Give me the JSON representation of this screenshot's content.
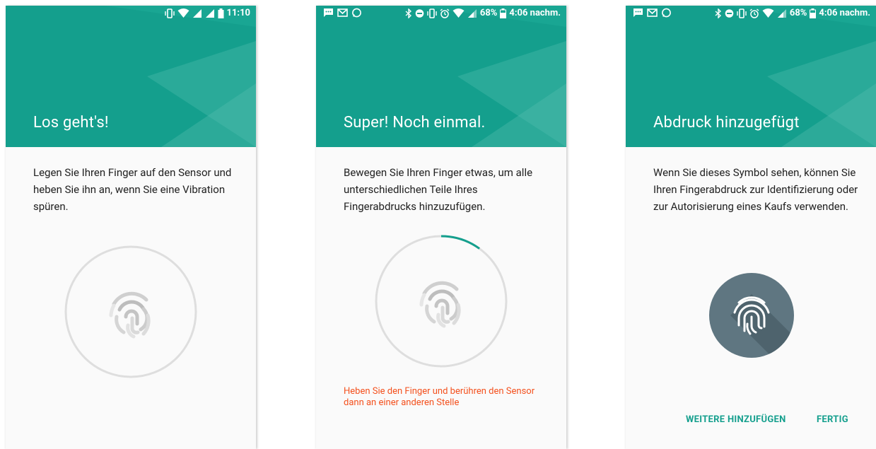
{
  "colors": {
    "header": "#149f8d",
    "accent": "#149f8d",
    "hint": "#f4511e",
    "badge": "#5f7681",
    "ring": "#dedede"
  },
  "screens": [
    {
      "status": {
        "icons": [
          "vibrate-icon",
          "wifi-icon",
          "signal-icon",
          "signal-icon",
          "battery-icon"
        ],
        "time": "11:10"
      },
      "title": "Los geht's!",
      "body": "Legen Sie Ihren Finger auf den Sensor und heben Sie ihn an, wenn Sie eine Vibration spüren.",
      "progress": 0
    },
    {
      "status": {
        "left_icons": [
          "message-icon",
          "gmail-icon",
          "whatsapp-icon"
        ],
        "icons": [
          "bluetooth-icon",
          "dnd-icon",
          "vibrate-icon",
          "alarm-icon",
          "wifi-icon",
          "signal-icon",
          "battery-icon"
        ],
        "battery": "68%",
        "time": "4:06 nachm."
      },
      "title": "Super! Noch einmal.",
      "body": "Bewegen Sie Ihren Finger etwas, um alle unterschiedlichen Teile Ihres Fingerabdrucks hinzuzufügen.",
      "progress": 0.1,
      "hint": "Heben Sie den Finger und berühren den Sensor dann an einer anderen Stelle"
    },
    {
      "status": {
        "left_icons": [
          "message-icon",
          "gmail-icon",
          "whatsapp-icon"
        ],
        "icons": [
          "bluetooth-icon",
          "dnd-icon",
          "vibrate-icon",
          "alarm-icon",
          "wifi-icon",
          "signal-icon",
          "battery-icon"
        ],
        "battery": "68%",
        "time": "4:06 nachm."
      },
      "title": "Abdruck hinzugefügt",
      "body": "Wenn Sie dieses Symbol sehen, können Sie Ihren Fingerabdruck zur Identifizierung oder zur Autorisierung eines Kaufs verwenden.",
      "actions": {
        "add_more": "WEITERE HINZUFÜGEN",
        "done": "FERTIG"
      }
    }
  ]
}
